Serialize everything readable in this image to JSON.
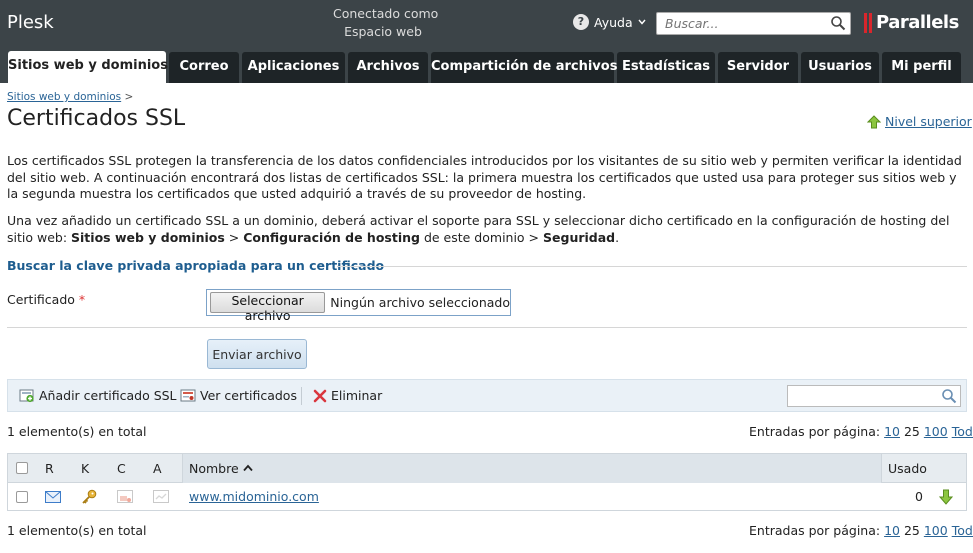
{
  "header": {
    "logo": "Plesk",
    "connected_line1": "Conectado como",
    "connected_line2": "Espacio web",
    "help_label": "Ayuda",
    "search_placeholder": "Buscar...",
    "brand": "Parallels"
  },
  "tabs": [
    {
      "label": "Sitios web y dominios",
      "active": true
    },
    {
      "label": "Correo"
    },
    {
      "label": "Aplicaciones"
    },
    {
      "label": "Archivos"
    },
    {
      "label": "Compartición de archivos"
    },
    {
      "label": "Estadísticas"
    },
    {
      "label": "Servidor"
    },
    {
      "label": "Usuarios"
    },
    {
      "label": "Mi perfil"
    }
  ],
  "breadcrumb": {
    "link": "Sitios web y dominios",
    "sep": ">"
  },
  "page": {
    "title": "Certificados SSL",
    "up_level": "Nivel superior",
    "desc1": "Los certificados SSL protegen la transferencia de los datos confidenciales introducidos por los visitantes de su sitio web y permiten verificar la identidad del sitio web. A continuación encontrará dos listas de certificados SSL: la primera muestra los certificados que usted usa para proteger sus sitios web y la segunda muestra los certificados que usted adquirió a través de su proveedor de hosting.",
    "desc2_a": "Una vez añadido un certificado SSL a un dominio, deberá activar el soporte para SSL y seleccionar dicho certificado en la configuración de hosting del sitio web: ",
    "desc2_b1": "Sitios web y dominios",
    "desc2_gt1": " > ",
    "desc2_b2": "Configuración de hosting",
    "desc2_mid": " de este dominio > ",
    "desc2_b3": "Seguridad",
    "desc2_end": "."
  },
  "form": {
    "section_title": "Buscar la clave privada apropiada para un certificado",
    "cert_label": "Certificado",
    "required_mark": "*",
    "file_button": "Seleccionar archivo",
    "file_status": "Ningún archivo seleccionado",
    "submit": "Enviar archivo"
  },
  "toolbar": {
    "add": "Añadir certificado SSL",
    "view": "Ver certificados",
    "delete": "Eliminar"
  },
  "list": {
    "total": "1 elemento(s) en total",
    "per_page_label": "Entradas por página:",
    "per_page_options": [
      "10",
      "25",
      "100",
      "Todas"
    ],
    "columns": {
      "r": "R",
      "k": "K",
      "c": "C",
      "a": "A",
      "name": "Nombre",
      "used": "Usado"
    },
    "rows": [
      {
        "name": "www.midominio.com",
        "used": "0"
      }
    ]
  },
  "colors": {
    "topbar": "#3c4448",
    "tab_dark": "#1e2427",
    "link": "#2a6496",
    "section": "#1e5d8f",
    "brand_red": "#d9262c"
  }
}
